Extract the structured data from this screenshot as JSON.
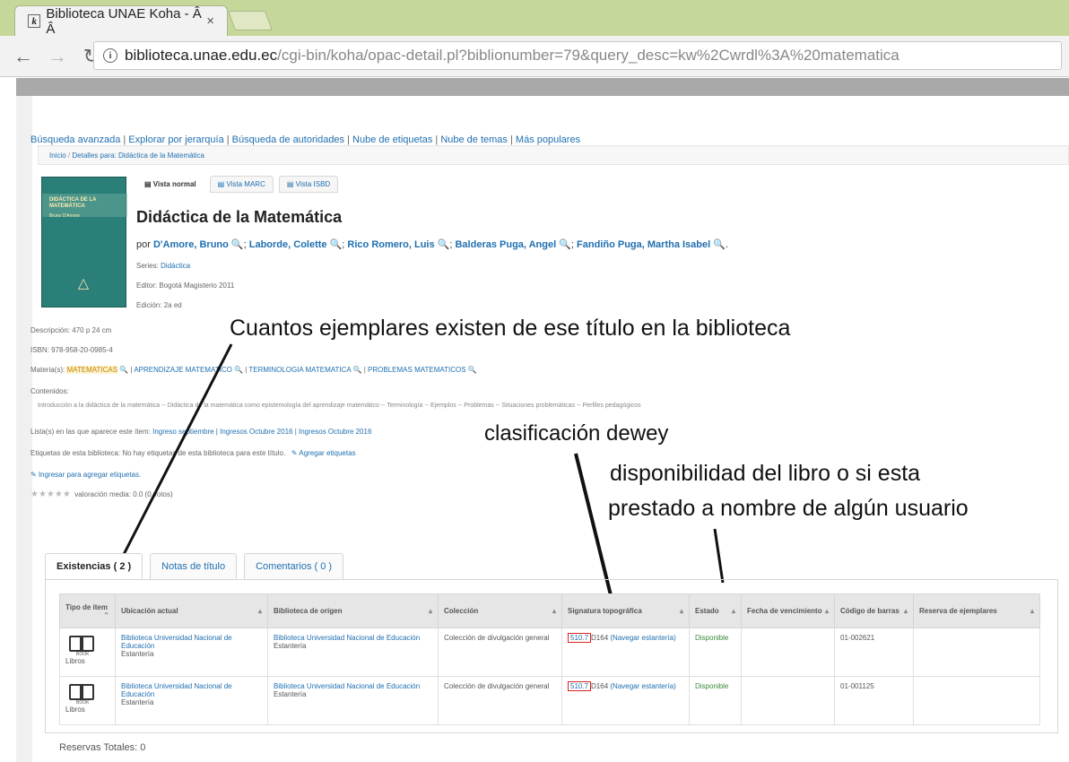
{
  "browser": {
    "tab_title": "Biblioteca UNAE Koha - Â Â",
    "tab_close": "×",
    "favicon": "k",
    "url_host": "biblioteca.unae.edu.ec",
    "url_path": "/cgi-bin/koha/opac-detail.pl?biblionumber=79&query_desc=kw%2Cwrdl%3A%20matematica"
  },
  "toplinks": [
    "Búsqueda avanzada",
    "Explorar por jerarquía",
    "Búsqueda de autoridades",
    "Nube de etiquetas",
    "Nube de temas",
    "Más populares"
  ],
  "breadcrumb": {
    "home": "Inicio",
    "current": "Detalles para: Didáctica de la Matemática"
  },
  "cover": {
    "title": "DIDÁCTICA DE LA MATEMÁTICA",
    "sub": "Bruno D'Amore"
  },
  "view_tabs": [
    "Vista normal",
    "Vista MARC",
    "Vista ISBD"
  ],
  "record": {
    "title": "Didáctica de la Matemática",
    "by": "por",
    "authors": [
      "D'Amore, Bruno",
      "Laborde, Colette",
      "Rico Romero, Luis",
      "Balderas Puga, Angel",
      "Fandiño Puga, Martha Isabel"
    ],
    "series_label": "Series:",
    "series": "Didáctica",
    "editor_label": "Editor:",
    "editor": "Bogotá Magisterio 2011",
    "edition_label": "Edición:",
    "edition": "2a ed",
    "description_label": "Descripción:",
    "description": "470 p 24 cm",
    "isbn_label": "ISBN:",
    "isbn": "978-958-20-0985-4",
    "subjects_label": "Materia(s):",
    "subjects": [
      "MATEMATICAS",
      "APRENDIZAJE MATEMATICO",
      "TERMINOLOGIA MATEMATICA",
      "PROBLEMAS MATEMATICOS"
    ],
    "contents_label": "Contenidos:",
    "contents": "Introducción a la didáctica de la matemática -- Didáctica de la matemática como epistemología del aprendizaje matemático -- Terminología -- Ejemplos -- Problemas -- Situaciones problemáticas -- Perfiles pedagógicos",
    "lists_label": "Lista(s) en las que aparece este ítem:",
    "lists": "Ingreso septiembre | Ingresos Octubre 2016 | Ingresos Octubre 2016",
    "tags_label": "Etiquetas de esta biblioteca:",
    "tags": "No hay etiquetas de esta biblioteca para este título.",
    "add_tags": "Agregar etiquetas",
    "login_tags": "Ingresar para agregar etiquetas.",
    "stars": "★★★★★",
    "rating": "valoración media: 0.0 (0 votos)"
  },
  "annotations": {
    "count": "Cuantos ejemplares existen de ese título en la biblioteca",
    "dewey": "clasificación dewey",
    "status_line1": "disponibilidad del libro o si esta",
    "status_line2": "prestado a nombre de algún usuario"
  },
  "holdings_tabs": [
    "Existencias ( 2 )",
    "Notas de título",
    "Comentarios ( 0 )"
  ],
  "holdings": {
    "headers": [
      "Tipo de ítem",
      "Ubicación actual",
      "Biblioteca de origen",
      "Colección",
      "Signatura topográfica",
      "Estado",
      "Fecha de vencimiento",
      "Código de barras",
      "Reserva de ejemplares"
    ],
    "rows": [
      {
        "type": "Libros",
        "type_small": "BOOK",
        "location": "Biblioteca Universidad Nacional de Educación",
        "shelf": "Estantería",
        "home": "Biblioteca Universidad Nacional de Educación",
        "home_shelf": "Estantería",
        "collection": "Colección de divulgación general",
        "callnum": "510.7",
        "callnum_rest": "D164",
        "browse": "(Navegar estantería)",
        "status": "Disponible",
        "due": "",
        "barcode": "01-002621",
        "hold": ""
      },
      {
        "type": "Libros",
        "type_small": "BOOK",
        "location": "Biblioteca Universidad Nacional de Educación",
        "shelf": "Estantería",
        "home": "Biblioteca Universidad Nacional de Educación",
        "home_shelf": "Estantería",
        "collection": "Colección de divulgación general",
        "callnum": "510.7",
        "callnum_rest": "D164",
        "browse": "(Navegar estantería)",
        "status": "Disponible",
        "due": "",
        "barcode": "01-001125",
        "hold": ""
      }
    ]
  },
  "total_holds": "Reservas Totales: 0"
}
